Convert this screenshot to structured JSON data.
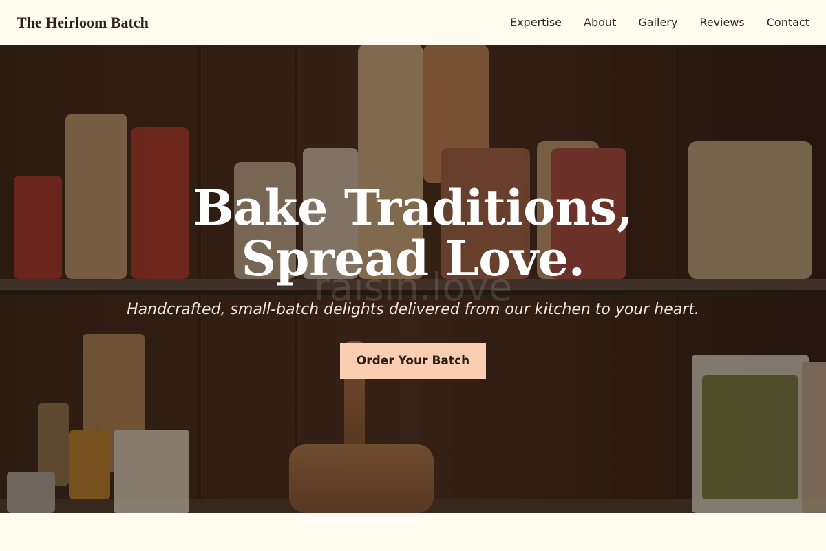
{
  "header": {
    "brand": "The Heirloom Batch",
    "nav": [
      {
        "label": "Expertise"
      },
      {
        "label": "About"
      },
      {
        "label": "Gallery"
      },
      {
        "label": "Reviews"
      },
      {
        "label": "Contact"
      }
    ]
  },
  "hero": {
    "title": "Bake Traditions, Spread Love.",
    "subtitle": "Handcrafted, small-batch delights delivered from our kitchen to your heart.",
    "cta_label": "Order Your Batch",
    "watermark": "raisin.love"
  },
  "colors": {
    "page_bg": "#fffbee",
    "cta_bg": "#fbcdb1",
    "hero_text": "#ffffff"
  }
}
